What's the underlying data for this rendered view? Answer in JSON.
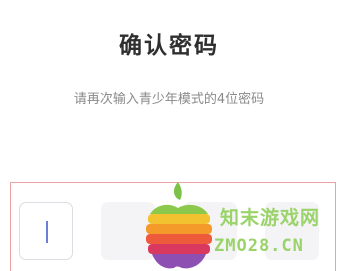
{
  "page": {
    "title": "确认密码",
    "subtitle": "请再次输入青少年模式的4位密码"
  },
  "pin_input": {
    "length": 4,
    "entered": ""
  },
  "watermark": {
    "cn": "知末游戏网",
    "en": "ZMO28.CN"
  },
  "colors": {
    "title": "#2f2f2f",
    "subtitle": "#8a8a8a",
    "cursor": "#6a7fd6",
    "pin_box_bg": "#f4f4f6",
    "highlight_border": "#e9a3a3",
    "watermark": "#9bd36b"
  }
}
